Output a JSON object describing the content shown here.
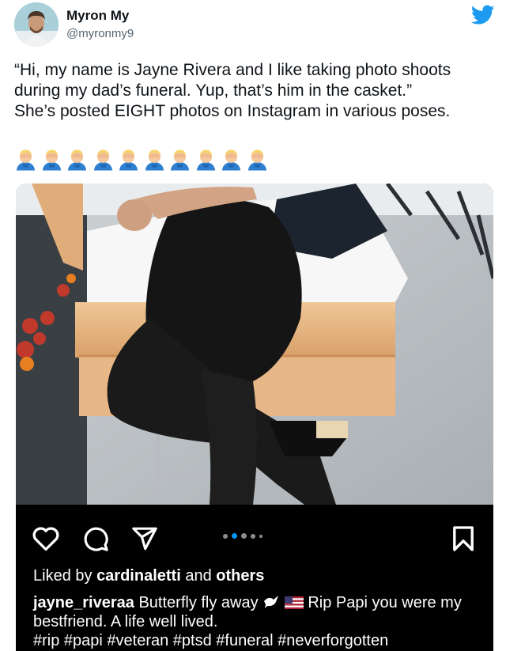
{
  "author": {
    "name": "Myron My",
    "handle": "@myronmy9"
  },
  "tweet": {
    "line1": "“Hi, my name is Jayne Rivera and I like taking photo shoots during my dad’s funeral. Yup, that’s him in the casket.”",
    "line2": "She’s posted EIGHT photos on Instagram in various poses.",
    "emoji_name": "man-facepalming-emoji",
    "emoji_count": 10
  },
  "instagram": {
    "icons": [
      "heart-icon",
      "comment-icon",
      "share-icon",
      "bookmark-icon"
    ],
    "carousel_total": 5,
    "carousel_active": 1,
    "likes_prefix": "Liked by",
    "liked_by": "cardinaletti",
    "likes_and": "and",
    "likes_others": "others",
    "caption_user": "jayne_riveraa",
    "caption_text": "Butterfly fly away",
    "caption_text_2": "Rip Papi you were my bestfriend. A life well lived.",
    "hashtags": "#rip #papi #veteran #ptsd #funeral #neverforgotten"
  },
  "colors": {
    "twitter_blue": "#1d9bf0",
    "text_dark": "#0f1419",
    "handle_gray": "#536471",
    "carousel_active": "#0095f6"
  }
}
